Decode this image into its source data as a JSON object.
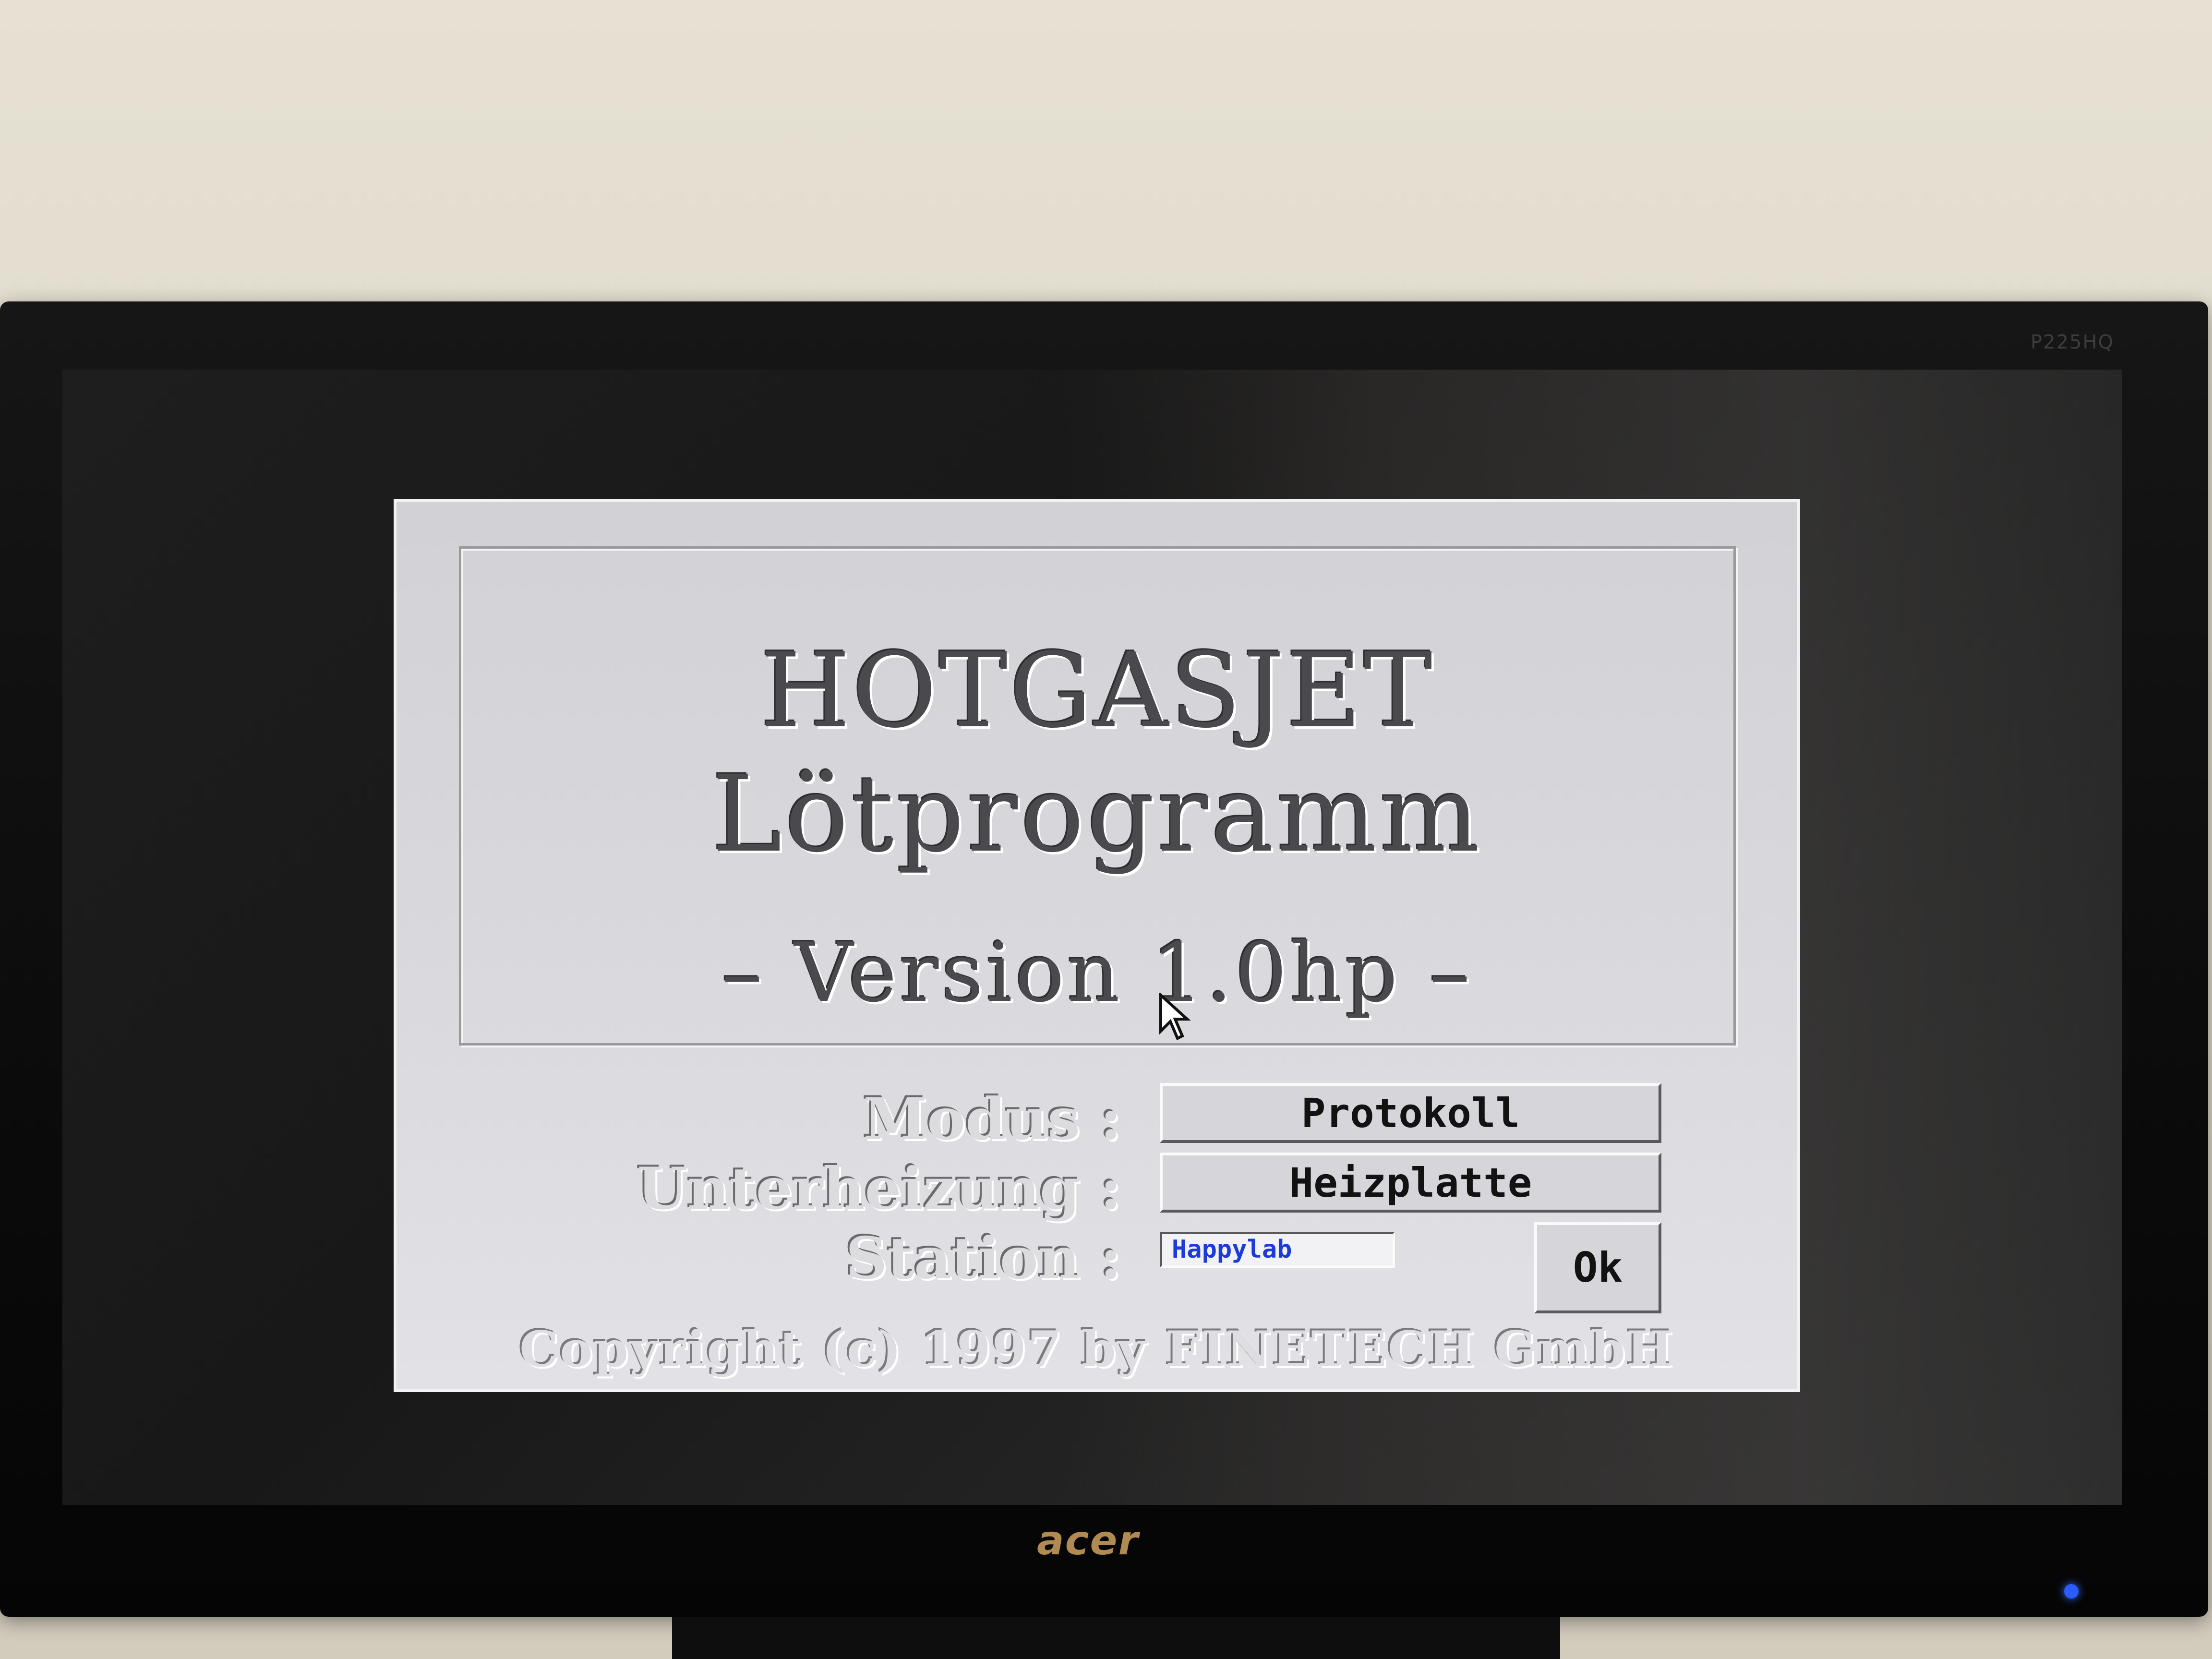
{
  "monitor": {
    "model": "P225HQ",
    "brand": "acer"
  },
  "dialog": {
    "title": "HOTGASJET",
    "subtitle": "Lötprogramm",
    "version": "– Version 1.0hp –",
    "fields": {
      "modus_label": "Modus :",
      "modus_value": "Protokoll",
      "unterheizung_label": "Unterheizung :",
      "unterheizung_value": "Heizplatte",
      "station_label": "Station :",
      "station_value": "Happylab"
    },
    "ok_label": "Ok",
    "copyright": "Copyright (c) 1997 by FINETECH GmbH"
  },
  "colors": {
    "dialog_bg": "#d9d9dd",
    "station_text": "#1d3bd8",
    "power_led": "#2a5cff"
  }
}
